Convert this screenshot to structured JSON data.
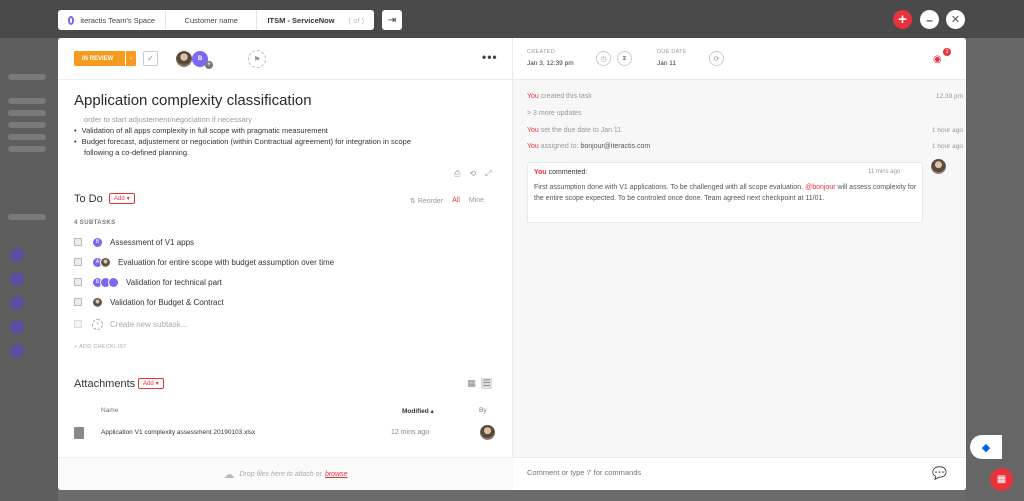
{
  "breadcrumb": {
    "space": "iteractis Team's Space",
    "customer": "Customer name",
    "project": "ITSM - ServiceNow",
    "position": "( of )"
  },
  "task": {
    "status": "IN REVIEW",
    "assignee_initial": "B",
    "title": "Application complexity classification",
    "description": {
      "cut_line": "order to start adjustement/negociation if necessary",
      "bullets": [
        "Validation of all apps complexity in full scope with pragmatic measurement",
        "Budget forecast, adjustement or negociation (within Contractual agreement) for integration in scope"
      ],
      "continuation": "following a co-defined planning."
    }
  },
  "todo": {
    "heading": "To Do",
    "add_label": "Add",
    "filters": {
      "reorder": "Reorder",
      "all": "All",
      "mine": "Mine"
    },
    "subtask_count": "4 SUBTASKS",
    "subtasks": [
      {
        "label": "Assessment of V1 apps",
        "avatars": [
          "B"
        ]
      },
      {
        "label": "Evaluation for entire scope with budget assumption over time",
        "avatars": [
          "A",
          "photo"
        ]
      },
      {
        "label": "Validation for technical part",
        "avatars": [
          "B",
          "",
          ""
        ]
      },
      {
        "label": "Validation for Budget & Contract",
        "avatars": [
          "photo"
        ]
      }
    ],
    "new_subtask_placeholder": "Create new subtask...",
    "add_checklist": "+ ADD CHECKLIST"
  },
  "attachments": {
    "heading": "Attachments",
    "add_label": "Add",
    "columns": {
      "name": "Name",
      "modified": "Modified",
      "by": "By"
    },
    "files": [
      {
        "name": "Application V1 complexity assessment 20190103.xlsx",
        "modified": "12 mins ago"
      }
    ],
    "dropzone_text": "Drop files here to attach or",
    "browse": "browse"
  },
  "meta": {
    "created_label": "CREATED",
    "created_value": "Jan 3, 12:39 pm",
    "due_label": "DUE DATE",
    "due_value": "Jan 11",
    "watch_count": "3"
  },
  "activity": [
    {
      "you": "You",
      "text": " created this task",
      "time": "12:39 pm"
    },
    {
      "you": "",
      "text": "> 3 more updates",
      "time": ""
    },
    {
      "you": "You",
      "text": " set the due date to Jan 11",
      "time": "1 hour ago"
    },
    {
      "you": "You",
      "text": " assigned to: ",
      "mail": "bonjour@iteractis.com",
      "time": "1 hour ago"
    }
  ],
  "comment": {
    "author": "You",
    "action": " commented:",
    "time": "11 mins ago",
    "body_1": "First assumption done with V1 applications. To be challenged with all scope evaluation. ",
    "mention": "@bonjour",
    "body_2": " will assess complexity for the entire scope expected. To be controled once done. Team agreed next checkpoint at 11/01."
  },
  "composer": {
    "placeholder": "Comment or type '/' for commands"
  },
  "colors": {
    "accent": "#e8323c",
    "status": "#f69b1f",
    "brand": "#7b68ee"
  }
}
